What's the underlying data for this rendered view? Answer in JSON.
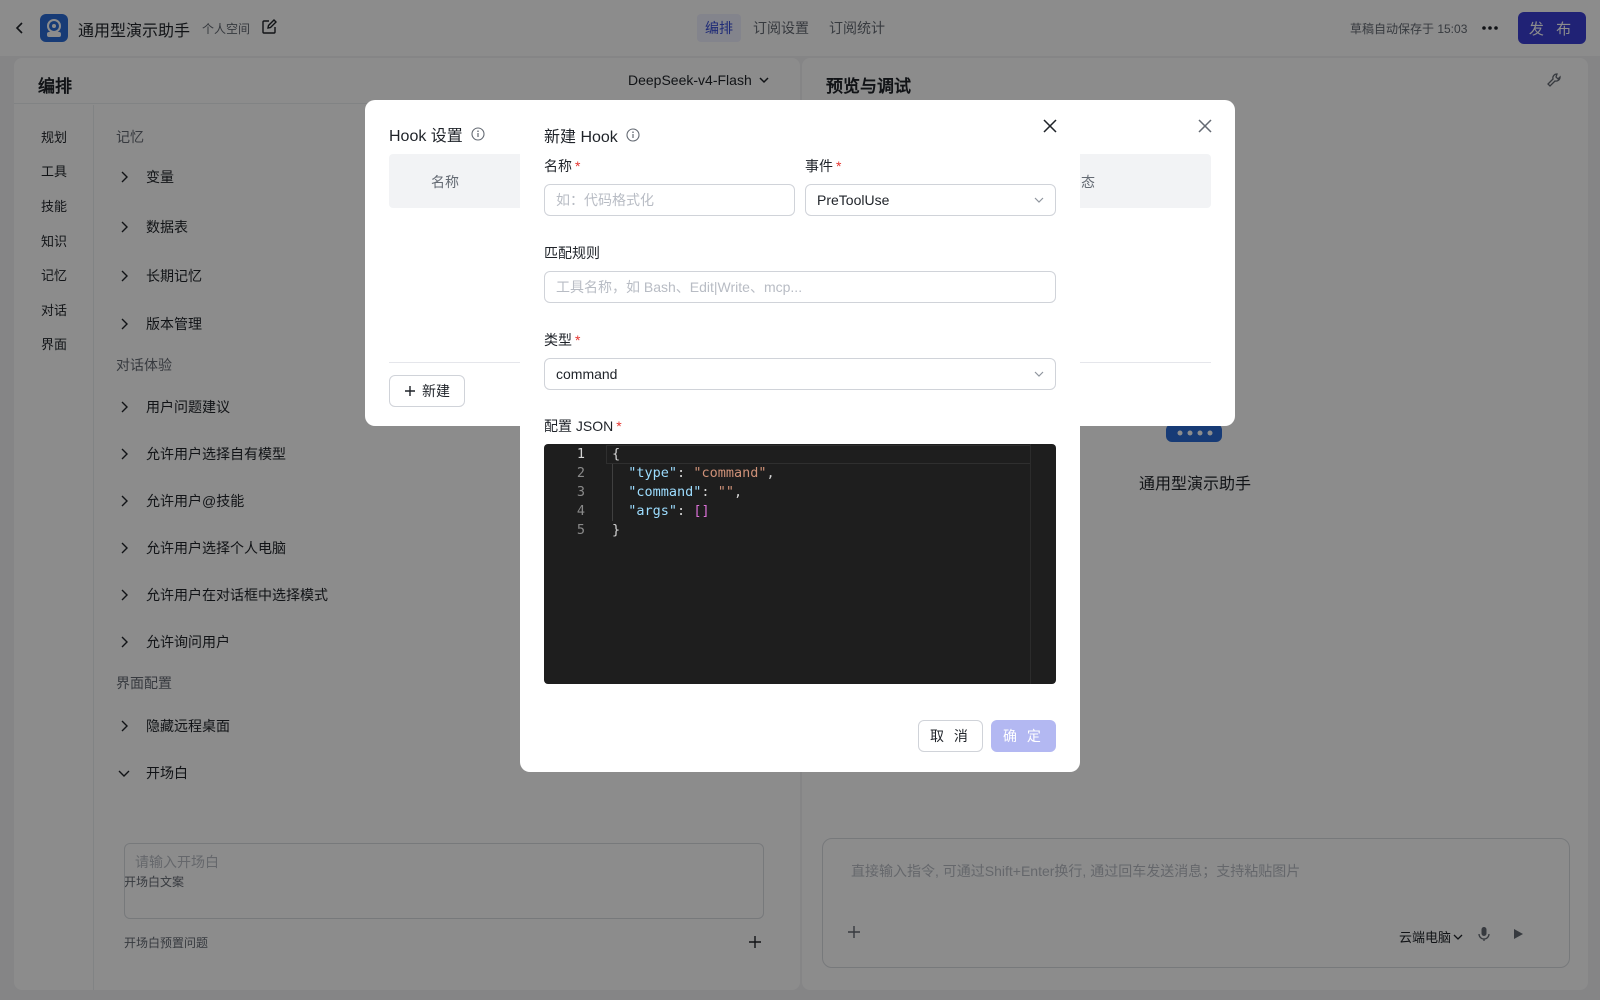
{
  "topbar": {
    "app_title": "通用型演示助手",
    "space_label": "个人空间",
    "tabs": [
      {
        "label": "编排",
        "active": true
      },
      {
        "label": "订阅设置",
        "active": false
      },
      {
        "label": "订阅统计",
        "active": false
      }
    ],
    "autosave_text": "草稿自动保存于 15:03",
    "publish_label": "发 布",
    "accent_color": "#3b3fd6"
  },
  "left_panel": {
    "title": "编排",
    "model": "DeepSeek-v4-Flash",
    "nav": [
      "规划",
      "工具",
      "技能",
      "知识",
      "记忆",
      "对话",
      "界面"
    ],
    "sections": {
      "memory": "记忆",
      "memory_items": [
        "变量",
        "数据表",
        "长期记忆",
        "版本管理"
      ],
      "chat_experience": "对话体验",
      "chat_items": [
        "用户问题建议",
        "允许用户选择自有模型",
        "允许用户@技能",
        "允许用户选择个人电脑",
        "允许用户在对话框中选择模式",
        "允许询问用户"
      ],
      "ui_config": "界面配置",
      "ui_items": [
        "隐藏远程桌面",
        "开场白"
      ],
      "opening_text_label": "开场白文案",
      "opening_placeholder": "请输入开场白",
      "opening_questions_label": "开场白预置问题"
    }
  },
  "right_panel": {
    "title": "预览与调试",
    "bot_name": "通用型演示助手",
    "chat_placeholder": "直接输入指令, 可通过Shift+Enter换行, 通过回车发送消息；支持粘贴图片",
    "cloud_pc_label": "云端电脑"
  },
  "hook_modal": {
    "title": "Hook 设置",
    "columns": [
      "名称",
      "态"
    ],
    "new_label": "新建"
  },
  "new_hook_modal": {
    "title": "新建 Hook",
    "name_label": "名称",
    "name_placeholder": "如：代码格式化",
    "event_label": "事件",
    "event_value": "PreToolUse",
    "match_label": "匹配规则",
    "match_placeholder": "工具名称，如 Bash、Edit|Write、mcp...",
    "type_label": "类型",
    "type_value": "command",
    "config_label": "配置 JSON",
    "required_mark": "*",
    "code_lines": [
      {
        "no": "1",
        "text": "{"
      },
      {
        "no": "2",
        "text": "  \"type\": \"command\","
      },
      {
        "no": "3",
        "text": "  \"command\": \"\","
      },
      {
        "no": "4",
        "text": "  \"args\": []"
      },
      {
        "no": "5",
        "text": "}"
      }
    ],
    "cancel_label": "取 消",
    "ok_label": "确 定"
  }
}
